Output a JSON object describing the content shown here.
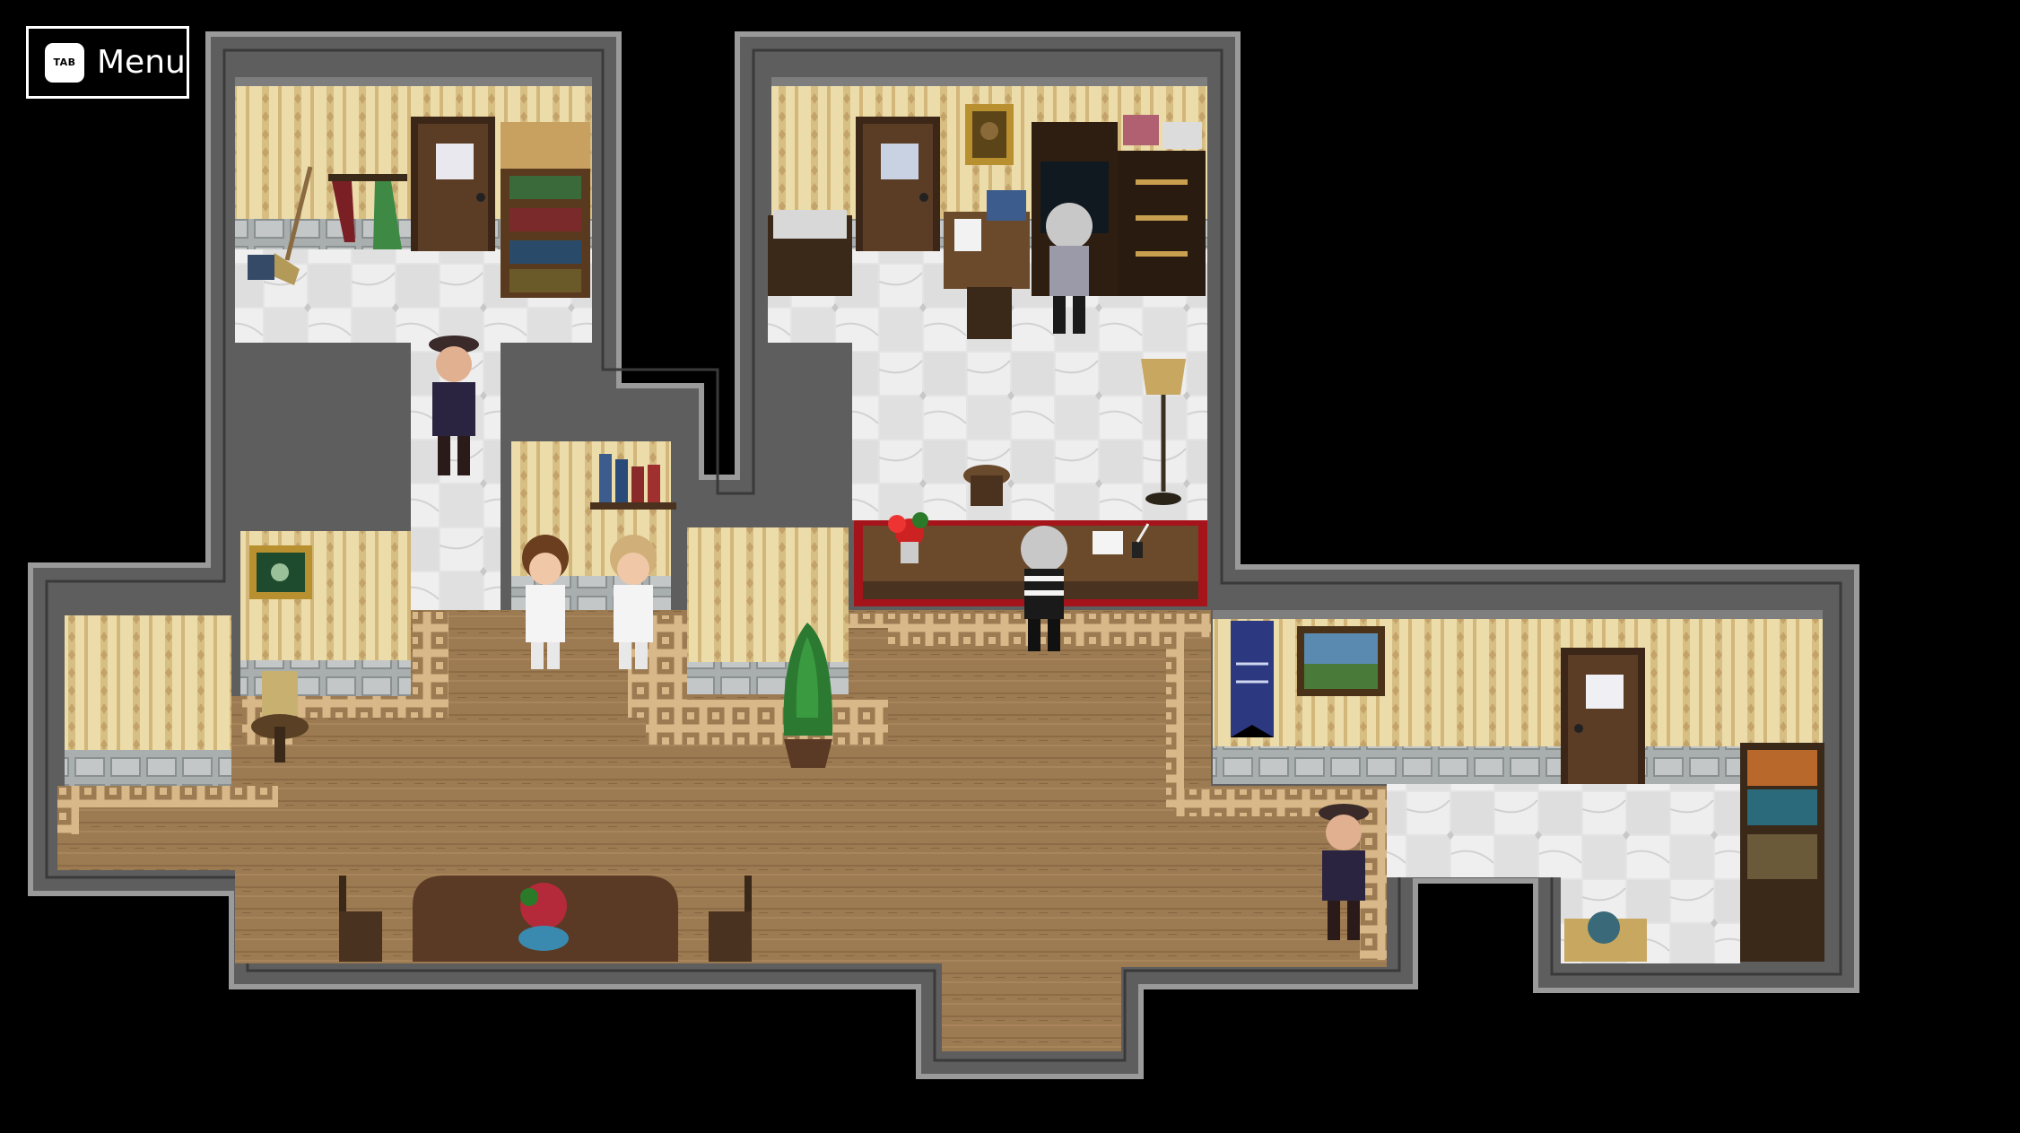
{
  "hud": {
    "menu_key": "TAB",
    "menu_label": "Menu"
  },
  "palette": {
    "wall_stripe": "#e9d7a4",
    "wall_stripe_dark": "#c9ac6e",
    "wainscot": "#9aa0a0",
    "floor_tile": "#e6e6e6",
    "carpet": "#9a7850",
    "carpet_border": "#d2b082",
    "outer_wall": "#6c6c6c",
    "wood": "#4a3322",
    "counter_red": "#b0141c"
  },
  "scene": {
    "npcs": [
      {
        "name": "guard-npc-hallway",
        "kind": "guard"
      },
      {
        "name": "resident-npc-brown-hair",
        "kind": "resident"
      },
      {
        "name": "resident-npc-blonde",
        "kind": "resident"
      },
      {
        "name": "clerk-npc-office",
        "kind": "elder"
      },
      {
        "name": "receptionist-npc-counter",
        "kind": "elder"
      },
      {
        "name": "guard-npc-east",
        "kind": "guard"
      }
    ]
  }
}
